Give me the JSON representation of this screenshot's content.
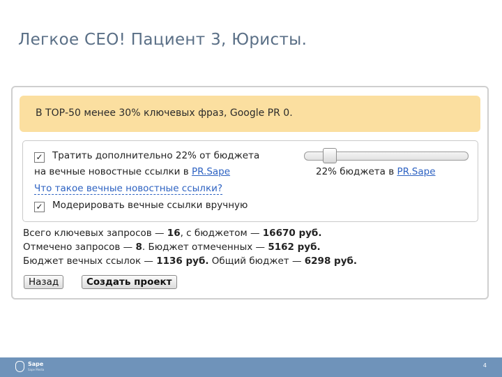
{
  "slide": {
    "title": "Легкое СЕО! Пациент 3, Юристы.",
    "page_number": "4"
  },
  "notice": {
    "text": "В ТОР-50 менее 30% ключевых фраз, Google PR 0."
  },
  "options": {
    "spend_checkbox_checked": true,
    "spend_line1": "Тратить дополнительно 22% от бюджета",
    "spend_line2_prefix": "на вечные новостные ссылки в ",
    "spend_link": "PR.Sape",
    "help_link": "Что такое вечные новостные ссылки?",
    "moderate_checkbox_checked": true,
    "moderate_label": "Модерировать вечные ссылки вручную",
    "slider_value_percent": 22,
    "slider_caption_prefix": "22% бюджета в ",
    "slider_caption_link": "PR.Sape"
  },
  "summary": {
    "line1_a": "Всего ключевых запросов — ",
    "line1_b": "16",
    "line1_c": ", с бюджетом — ",
    "line1_d": "16670 руб.",
    "line2_a": "Отмечено запросов — ",
    "line2_b": "8",
    "line2_c": ". Бюджет отмеченных — ",
    "line2_d": "5162 руб.",
    "line3_a": "Бюджет вечных ссылок — ",
    "line3_b": "1136 руб.",
    "line3_c": " Общий бюджет — ",
    "line3_d": "6298 руб."
  },
  "buttons": {
    "back": "Назад",
    "create": "Создать проект"
  },
  "footer": {
    "logo_text": "Sape",
    "logo_sub": "Sape Media"
  },
  "colors": {
    "title": "#5a6f86",
    "notice_bg": "#fbdfa0",
    "link": "#2d62c2",
    "footer_bg": "#6f93ba"
  }
}
